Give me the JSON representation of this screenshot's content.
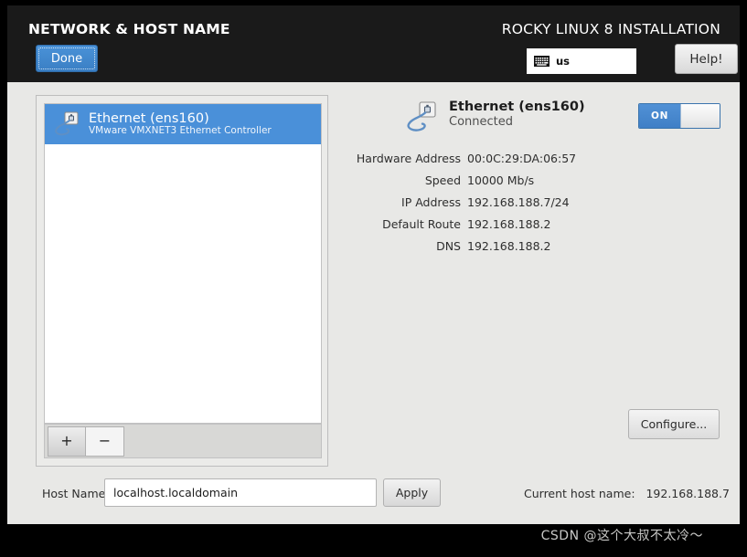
{
  "header": {
    "spoke_title": "NETWORK & HOST NAME",
    "done_label": "Done",
    "product_title": "ROCKY LINUX 8 INSTALLATION",
    "keyboard_layout": "us",
    "keyboard_icon": "keyboard-icon",
    "help_label": "Help!"
  },
  "device_list": {
    "items": [
      {
        "name": "Ethernet (ens160)",
        "description": "VMware VMXNET3 Ethernet Controller",
        "icon": "wired-network-icon",
        "selected": true
      }
    ],
    "add_label": "+",
    "remove_label": "−"
  },
  "detail": {
    "icon": "wired-network-icon",
    "title": "Ethernet (ens160)",
    "state": "Connected",
    "toggle": {
      "label": "ON",
      "state": "on",
      "accent_color": "#4a90d9"
    },
    "rows": [
      {
        "label": "Hardware Address",
        "value": "00:0C:29:DA:06:57"
      },
      {
        "label": "Speed",
        "value": "10000 Mb/s"
      },
      {
        "label": "IP Address",
        "value": "192.168.188.7/24"
      },
      {
        "label": "Default Route",
        "value": "192.168.188.2"
      },
      {
        "label": "DNS",
        "value": "192.168.188.2"
      }
    ],
    "configure_label": "Configure..."
  },
  "hostname": {
    "label": "Host Name:",
    "value": "localhost.localdomain",
    "apply_label": "Apply",
    "current_label": "Current host name:   192.168.188.7"
  },
  "watermark": "CSDN @这个大叔不太冷～",
  "colors": {
    "header_bg": "#1a1a1a",
    "content_bg": "#e8e8e6",
    "accent": "#4a90d9"
  }
}
